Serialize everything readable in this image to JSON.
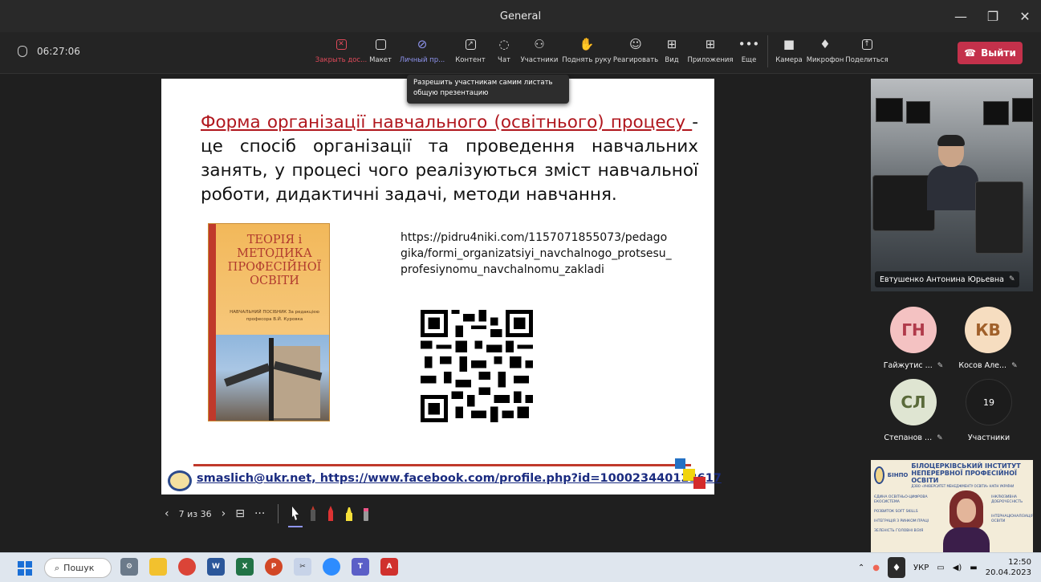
{
  "window": {
    "title": "General"
  },
  "toolbar": {
    "timer": "06:27:06",
    "tools": [
      {
        "label": "Закрыть дос...",
        "icon": "close-share-icon",
        "glyph": "✕"
      },
      {
        "label": "Макет",
        "icon": "layout-icon",
        "glyph": ""
      },
      {
        "label": "Личный пр...",
        "icon": "private-view-icon",
        "glyph": "◉"
      },
      {
        "label": "Контент",
        "icon": "content-icon",
        "glyph": "↗"
      },
      {
        "label": "Чат",
        "icon": "chat-icon",
        "glyph": "☺"
      },
      {
        "label": "Участники",
        "icon": "participants-icon",
        "glyph": "♂"
      },
      {
        "label": "Поднять руку",
        "icon": "raise-hand-icon",
        "glyph": "✋"
      },
      {
        "label": "Реагировать",
        "icon": "react-icon",
        "glyph": "☺"
      },
      {
        "label": "Вид",
        "icon": "view-icon",
        "glyph": "⊞"
      },
      {
        "label": "Приложения",
        "icon": "apps-icon",
        "glyph": "⊕"
      },
      {
        "label": "Еще",
        "icon": "more-icon",
        "glyph": "•••"
      },
      {
        "label": "Камера",
        "icon": "camera-icon",
        "glyph": "■"
      },
      {
        "label": "Микрофон",
        "icon": "microphone-icon",
        "glyph": "🎙"
      },
      {
        "label": "Поделиться",
        "icon": "share-icon",
        "glyph": "↑"
      }
    ],
    "leave_label": "Выйти"
  },
  "tooltip": "Разрешить участникам самим листать общую презентацию",
  "slide": {
    "term": "Форма організації навчального (освітнього) процесу ",
    "definition": "- це спосіб організації та проведення навчальних занять, у процесі чого реалізуються зміст навчальної роботи, дидактичні задачі, методи навчання.",
    "book": {
      "title": "ТЕОРІЯ і МЕТОДИКА ПРОФЕСІЙНОЇ ОСВІТИ",
      "subtitle": "НАВЧАЛЬНИЙ ПОСІБНИК За редакцією професора В.Й. Куровка"
    },
    "url": "https://pidru4niki.com/1157071855073/pedagogika/formi_organizatsiyi_navchalnogo_protsesu_profesiynomu_navchalnomu_zakladi",
    "footer": "smaslich@ukr.net, https://www.facebook.com/profile.php?id=100023440123617"
  },
  "slide_controls": {
    "page": "7 из 36"
  },
  "participants": {
    "main_video_name": "Евтушенко Антонина Юрьевна",
    "tiles": [
      {
        "initials": "ГН",
        "name": "Гайжутис ...",
        "bg": "#f4c2c2",
        "fg": "#b03a4a"
      },
      {
        "initials": "КВ",
        "name": "Косов Але...",
        "bg": "#f6ddc0",
        "fg": "#a0602a"
      },
      {
        "initials": "СЛ",
        "name": "Степанов ...",
        "bg": "#dfe5d2",
        "fg": "#5a6a3a"
      },
      {
        "initials": "19",
        "name": "Участники",
        "bg": "#1c1c1c",
        "fg": "#ffffff"
      }
    ]
  },
  "bottom_video": {
    "abbr": "БІНПО",
    "title": "БІЛОЦЕРКІВСЬКИЙ ІНСТИТУТ НЕПЕРЕРВНОЇ ПРОФЕСІЙНОЇ ОСВІТИ",
    "subtitle": "ДЗВО «УНІВЕРСИТЕТ МЕНЕДЖМЕНТУ ОСВІТИ» НАПН УКРАЇНИ",
    "left_items": [
      "ЄДИНА ОСВІТНЬО-ЦИФРОВА ЕКОСИСТЕМА",
      "РОЗВИТОК SOFT SKILLS",
      "ІНТЕГРАЦІЯ З РИНКОМ ПРАЦІ",
      "ЗЕЛЕНІСТЬ ГОЛОВНІ ВІЗІЯ"
    ],
    "right_items": [
      "ІНКЛЮЗИВНА ДОБРОЧЕСНІСТЬ",
      "ІНТЕРНАЦІОНАЛІЗАЦІЯ ОСВІТИ"
    ]
  },
  "taskbar": {
    "search_label": "Пошук",
    "language": "УКР",
    "time": "12:50",
    "date": "20.04.2023"
  },
  "colors": {
    "accent_active": "#8f95f0",
    "danger": "#c4314b",
    "slide_term": "#b0161d",
    "footer_link": "#1a2b80"
  }
}
